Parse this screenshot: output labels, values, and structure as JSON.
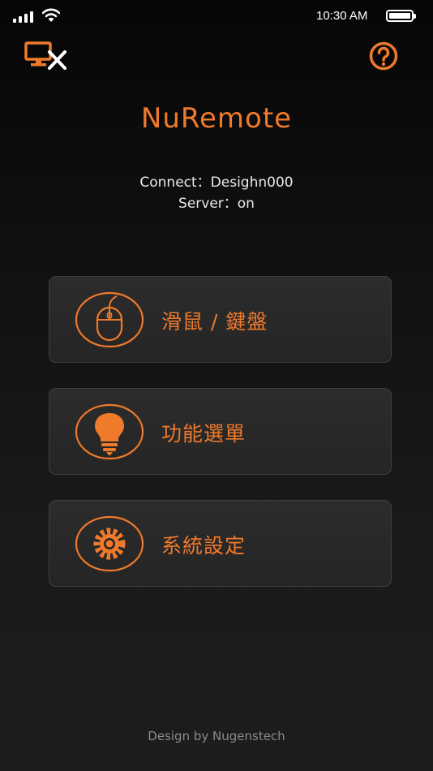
{
  "status_bar": {
    "time": "10:30 AM",
    "icons": [
      "signal-icon",
      "wifi-icon",
      "battery-icon"
    ]
  },
  "toolbar": {
    "disconnect_icon": "monitor-disconnect-icon",
    "help_icon": "help-icon"
  },
  "app_title": "NuRemote",
  "connection": {
    "connect_line": "Connect：Desighn000",
    "server_line": "Server：on"
  },
  "menu": [
    {
      "label": "滑鼠 / 鍵盤",
      "icon": "mouse-icon"
    },
    {
      "label": "功能選單",
      "icon": "lightbulb-icon"
    },
    {
      "label": "系統設定",
      "icon": "gear-icon"
    }
  ],
  "footer": "Design by Nugenstech",
  "colors": {
    "accent": "#f07a2b",
    "button_bg": "#2a2a2a",
    "button_border": "#3f3f3f",
    "footer_text": "#8a8a8a"
  }
}
